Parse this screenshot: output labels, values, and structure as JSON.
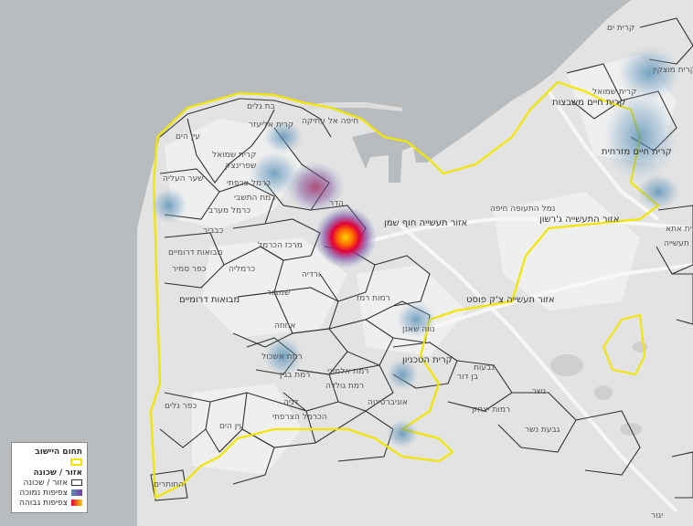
{
  "colors": {
    "sea": "#b9bcbf",
    "land": "#e6e6e6",
    "city_boundary": "#f2e600",
    "neighborhood_outline": "#333333",
    "heat_low": "#5a8fb3",
    "heat_high": "#e3003a",
    "heat_peak": "#ffd400"
  },
  "labels": [
    {
      "text": "בת גלים"
    },
    {
      "text": "קרית אליעזר"
    },
    {
      "text": "חיפה אל עתיקה"
    },
    {
      "text": "עין הים"
    },
    {
      "text": "קרית שמואל"
    },
    {
      "text": "שער העליה"
    },
    {
      "text": "שפרינצק"
    },
    {
      "text": "כרמל צרפתי"
    },
    {
      "text": "רמת התשבי"
    },
    {
      "text": "כרמל מערבי"
    },
    {
      "text": "כבביר"
    },
    {
      "text": "מרכז הכרמל"
    },
    {
      "text": "כרמליה"
    },
    {
      "text": "מבואות דרומיים"
    },
    {
      "text": "כפר סמיר"
    },
    {
      "text": "מבואות דרומיים"
    },
    {
      "text": "אזור תעשייה חוף שמן"
    },
    {
      "text": "נמל התעופה חיפה"
    },
    {
      "text": "אזור התעשייה ג'רשון"
    },
    {
      "text": "אזור תעשייה צ'ק פוסט"
    },
    {
      "text": "קרית חיים משבצות"
    },
    {
      "text": "קרית חיים מזרחית"
    },
    {
      "text": "קרית ים"
    },
    {
      "text": "קרית מוצקין"
    },
    {
      "text": "קרית שמואל"
    },
    {
      "text": "הדר"
    },
    {
      "text": "רמות רמז"
    },
    {
      "text": "ורדיה"
    },
    {
      "text": "שמבור"
    },
    {
      "text": "אחוזה"
    },
    {
      "text": "רמת אשכול"
    },
    {
      "text": "רמת בגין"
    },
    {
      "text": "נווה שאנן"
    },
    {
      "text": "קרית הטכניון"
    },
    {
      "text": "רמת אלמוגי"
    },
    {
      "text": "רמת גולדה"
    },
    {
      "text": "אוניברסיטה"
    },
    {
      "text": "הכרמל הצרפתי"
    },
    {
      "text": "דניה"
    },
    {
      "text": "כפר גלים"
    },
    {
      "text": "עין הים"
    },
    {
      "text": "החותרים"
    },
    {
      "text": "יגור"
    },
    {
      "text": "גבעת נשר"
    },
    {
      "text": "רמות יצחק"
    },
    {
      "text": "נשר"
    },
    {
      "text": "בן דור"
    },
    {
      "text": "גבעות"
    },
    {
      "text": "קרית אתא"
    },
    {
      "text": "אזור תעשייה"
    }
  ],
  "legend": {
    "title": "תחום היישוב",
    "subtitle": "אזור / שכונה",
    "items": [
      {
        "label": "אזור / שכונה"
      },
      {
        "label": "צפיפות נמוכה"
      },
      {
        "label": "צפיפות גבוהה"
      }
    ]
  }
}
